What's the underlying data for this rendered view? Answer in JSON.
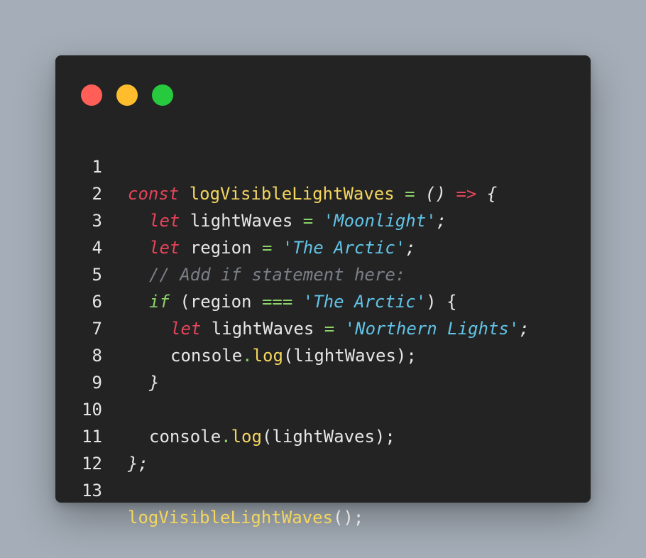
{
  "window": {
    "controls": {
      "close_color": "#ff5f56",
      "minimize_color": "#ffbd2e",
      "maximize_color": "#27c93f"
    }
  },
  "code": {
    "line_numbers": [
      "1",
      "2",
      "3",
      "4",
      "5",
      "6",
      "7",
      "8",
      "9",
      "10",
      "11",
      "12",
      "13"
    ],
    "l1": {
      "kw": "const",
      "name": "logVisibleLightWaves",
      "eq": "=",
      "parens": "()",
      "arrow": "=>",
      "brace": "{"
    },
    "l2": {
      "kw": "let",
      "ident": "lightWaves",
      "eq": "=",
      "str": "'Moonlight'",
      "semi": ";"
    },
    "l3": {
      "kw": "let",
      "ident": "region",
      "eq": "=",
      "str": "'The Arctic'",
      "semi": ";"
    },
    "l4": {
      "comment": "// Add if statement here:"
    },
    "l5": {
      "kw": "if",
      "open": "(region",
      "op": "===",
      "str": "'The Arctic'",
      "close": ") {"
    },
    "l6": {
      "kw": "let",
      "ident": "lightWaves",
      "eq": "=",
      "str": "'Northern Lights'",
      "semi": ";"
    },
    "l7": {
      "obj": "console",
      "dot": ".",
      "method": "log",
      "args": "(lightWaves);"
    },
    "l8": {
      "brace": "}"
    },
    "l10": {
      "obj": "console",
      "dot": ".",
      "method": "log",
      "args": "(lightWaves);"
    },
    "l11": {
      "brace": "}",
      "semi": ";"
    },
    "l13": {
      "name": "logVisibleLightWaves",
      "call": "();"
    }
  }
}
